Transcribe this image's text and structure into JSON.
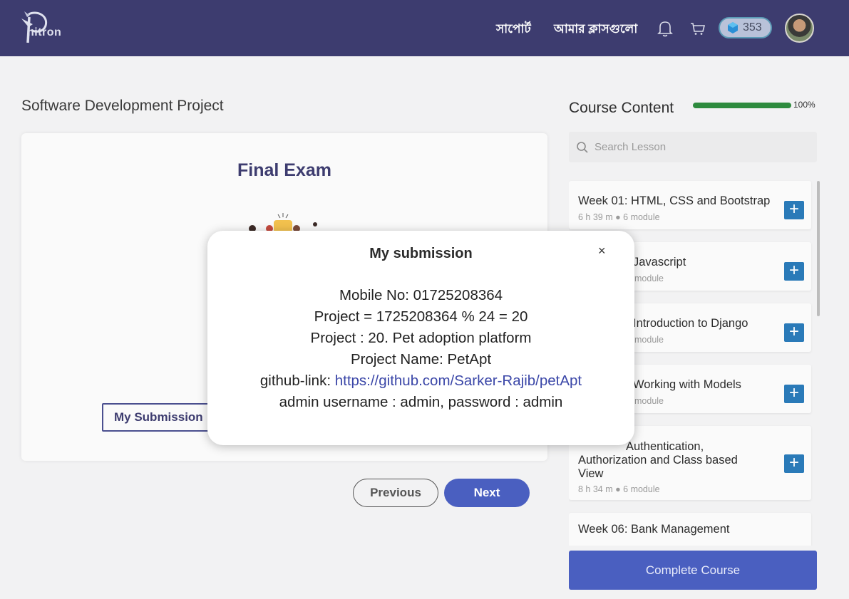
{
  "header": {
    "logo_text": "hitron",
    "nav": {
      "support": "সাপোর্ট",
      "my_classes": "আমার ক্লাসগুলো"
    },
    "points": "353"
  },
  "main": {
    "page_title": "Software Development Project",
    "exam_title": "Final Exam",
    "my_submission_button": "My Submission",
    "previous_button": "Previous",
    "next_button": "Next"
  },
  "sidebar": {
    "title": "Course Content",
    "progress_percent": 100,
    "progress_label": "100%",
    "search_placeholder": "Search Lesson",
    "lessons": [
      {
        "title": "Week 01: HTML, CSS and Bootstrap",
        "duration": "6 h 39 m",
        "modules": "6 module"
      },
      {
        "title": "Javascript",
        "duration": "",
        "modules": "module"
      },
      {
        "title": "Introduction to Django",
        "duration": "",
        "modules": "module"
      },
      {
        "title": "Working with Models",
        "duration": "",
        "modules": "module"
      },
      {
        "title": "Authentication, Authorization and Class based View",
        "title_line1": "Authentication,",
        "title_line2": "Authorization and Class based",
        "title_line3": "View",
        "duration": "8 h 34 m",
        "modules": "6 module"
      },
      {
        "title": "Week 06: Bank Management"
      }
    ],
    "complete_button": "Complete Course"
  },
  "modal": {
    "title": "My submission",
    "close": "×",
    "lines": {
      "mobile": "Mobile No: 01725208364",
      "project_calc": "Project = 1725208364 % 24 = 20",
      "project": "Project : 20. Pet adoption platform",
      "project_name": "Project Name: PetApt",
      "github_label": "github-link: ",
      "github_url": "https://github.com/Sarker-Rajib/petApt",
      "admin": "admin username : admin, password : admin"
    }
  },
  "colors": {
    "header_bg": "#3d3c6f",
    "accent": "#4a5fc0",
    "plus_button": "#2a7ab8",
    "progress": "#2e8b3e"
  }
}
